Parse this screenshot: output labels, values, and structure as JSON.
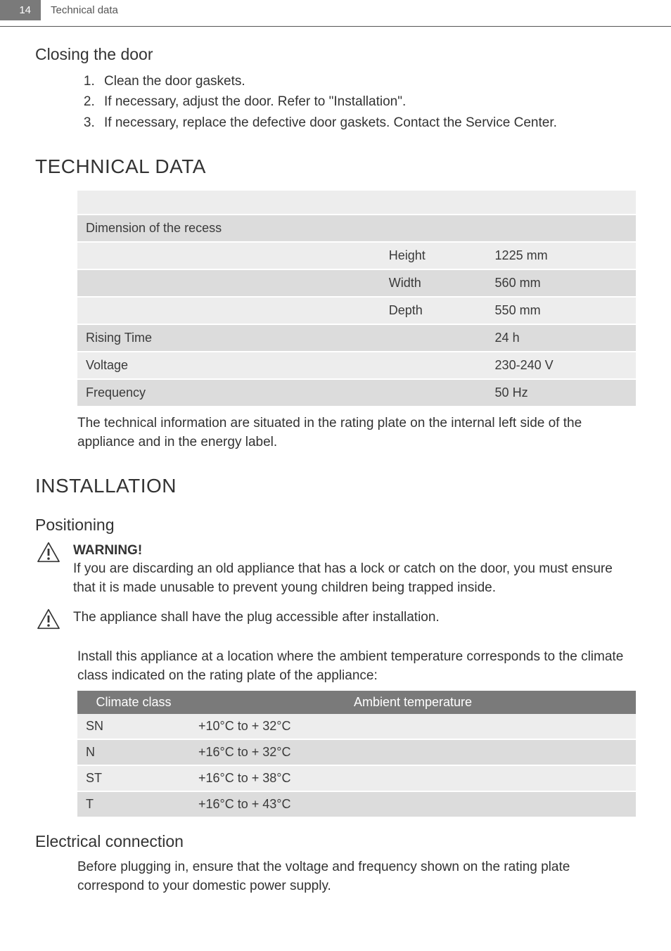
{
  "header": {
    "page_number": "14",
    "running_title": "Technical data"
  },
  "closing_door": {
    "heading": "Closing the door",
    "steps": [
      "Clean the door gaskets.",
      "If necessary, adjust the door. Refer to \"Installation\".",
      "If necessary, replace the defective door gaskets. Contact the Service Center."
    ]
  },
  "technical_data": {
    "heading": "TECHNICAL DATA",
    "rows": [
      {
        "c1": "Dimension of the recess",
        "c2": "",
        "c3": ""
      },
      {
        "c1": "",
        "c2": "Height",
        "c3": "1225 mm"
      },
      {
        "c1": "",
        "c2": "Width",
        "c3": "560 mm"
      },
      {
        "c1": "",
        "c2": "Depth",
        "c3": "550 mm"
      },
      {
        "c1": "Rising Time",
        "c2": "",
        "c3": "24 h"
      },
      {
        "c1": "Voltage",
        "c2": "",
        "c3": "230-240 V"
      },
      {
        "c1": "Frequency",
        "c2": "",
        "c3": "50 Hz"
      }
    ],
    "footnote": "The technical information are situated in the rating plate on the internal left side of the appliance and in the energy label."
  },
  "installation": {
    "heading": "INSTALLATION",
    "positioning_heading": "Positioning",
    "warning_label": "WARNING!",
    "warning_text": "If you are discarding an old appliance that has a lock or catch on the door, you must ensure that it is made unusable to prevent young children being trapped inside.",
    "plug_note": "The appliance shall have the plug accessible after installation.",
    "climate_intro": "Install this appliance at a location where the ambient temperature corresponds to the climate class indicated on the rating plate of the appliance:",
    "climate_table": {
      "headers": [
        "Climate class",
        "Ambient temperature"
      ],
      "rows": [
        {
          "class": "SN",
          "range": "+10°C to + 32°C"
        },
        {
          "class": "N",
          "range": "+16°C to + 32°C"
        },
        {
          "class": "ST",
          "range": "+16°C to + 38°C"
        },
        {
          "class": "T",
          "range": "+16°C to + 43°C"
        }
      ]
    },
    "electrical_heading": "Electrical connection",
    "electrical_text": "Before plugging in, ensure that the voltage and frequency shown on the rating plate correspond to your domestic power supply."
  }
}
